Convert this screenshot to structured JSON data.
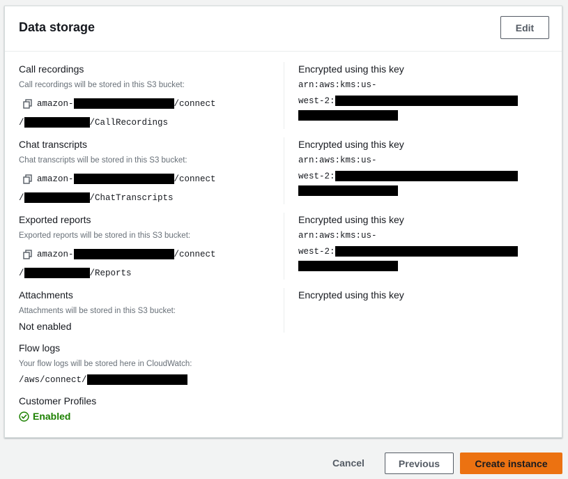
{
  "panel": {
    "title": "Data storage",
    "edit_label": "Edit"
  },
  "call_recordings": {
    "label": "Call recordings",
    "description": "Call recordings will be stored in this S3 bucket:",
    "bucket_prefix": "amazon-",
    "bucket_suffix": "/connect",
    "path_prefix": "/",
    "path_suffix": "/CallRecordings",
    "key_label": "Encrypted using this key",
    "key_line1": "arn:aws:kms:us-",
    "key_line2": "west-2:"
  },
  "chat_transcripts": {
    "label": "Chat transcripts",
    "description": "Chat transcripts will be stored in this S3 bucket:",
    "bucket_prefix": "amazon-",
    "bucket_suffix": "/connect",
    "path_prefix": "/",
    "path_suffix": "/ChatTranscripts",
    "key_label": "Encrypted using this key",
    "key_line1": "arn:aws:kms:us-",
    "key_line2": "west-2:"
  },
  "exported_reports": {
    "label": "Exported reports",
    "description": "Exported reports will be stored in this S3 bucket:",
    "bucket_prefix": "amazon-",
    "bucket_suffix": "/connect",
    "path_prefix": "/",
    "path_suffix": "/Reports",
    "key_label": "Encrypted using this key",
    "key_line1": "arn:aws:kms:us-",
    "key_line2": "west-2:"
  },
  "attachments": {
    "label": "Attachments",
    "description": "Attachments will be stored in this S3 bucket:",
    "value": "Not enabled",
    "key_label": "Encrypted using this key"
  },
  "flow_logs": {
    "label": "Flow logs",
    "description": "Your flow logs will be stored here in CloudWatch:",
    "value_prefix": "/aws/connect/"
  },
  "customer_profiles": {
    "label": "Customer Profiles",
    "status": "Enabled"
  },
  "footer": {
    "cancel_label": "Cancel",
    "previous_label": "Previous",
    "create_label": "Create instance"
  },
  "colors": {
    "primary_button": "#ec7211",
    "success": "#1d8102",
    "muted_text": "#687078"
  },
  "icons": [
    "copy-icon",
    "check-circle-icon"
  ]
}
